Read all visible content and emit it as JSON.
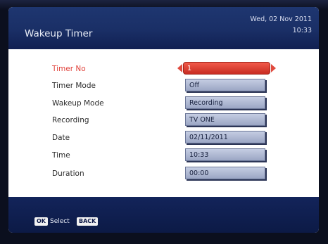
{
  "header": {
    "title": "Wakeup Timer",
    "date": "Wed, 02 Nov 2011",
    "time": "10:33"
  },
  "rows": [
    {
      "label": "Timer No",
      "value": "1",
      "active": true
    },
    {
      "label": "Timer Mode",
      "value": "Off"
    },
    {
      "label": "Wakeup Mode",
      "value": "Recording"
    },
    {
      "label": "Recording",
      "value": "TV ONE"
    },
    {
      "label": "Date",
      "value": "02/11/2011"
    },
    {
      "label": "Time",
      "value": "10:33"
    },
    {
      "label": "Duration",
      "value": "00:00"
    }
  ],
  "footer": {
    "ok_key": "OK",
    "ok_label": "Select",
    "back_key": "BACK"
  },
  "colors": {
    "accent": "#e0433c",
    "header_bg": "#1e3670",
    "field_bg": "#b3bcd6"
  }
}
